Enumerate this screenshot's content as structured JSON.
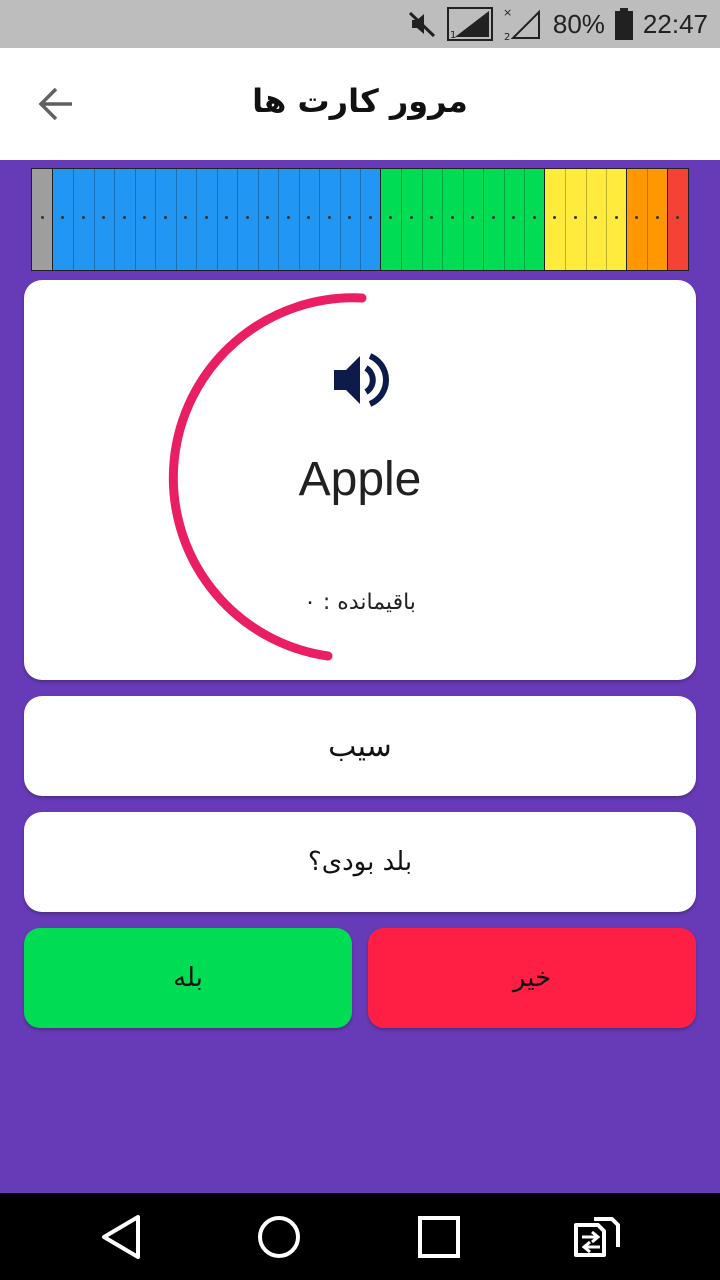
{
  "status_bar": {
    "battery_percent": "80%",
    "time": "22:47",
    "sim1_label": "1",
    "sim2_label": "2",
    "icons": [
      "mute-icon",
      "signal-sim1-icon",
      "signal-sim2-no-service-icon",
      "battery-icon"
    ]
  },
  "app_bar": {
    "title": "مرور کارت ها",
    "back_icon": "arrow-back-icon"
  },
  "leitner_boxes": [
    {
      "color": "#9e9e9e",
      "cells": 1
    },
    {
      "color": "#2196f3",
      "cells": 16
    },
    {
      "color": "#00dd55",
      "cells": 8
    },
    {
      "color": "#ffeb3b",
      "cells": 4
    },
    {
      "color": "#ff9800",
      "cells": 2
    },
    {
      "color": "#f44336",
      "cells": 1
    }
  ],
  "card": {
    "word": "Apple",
    "speaker_icon": "volume-up-icon",
    "remaining_label": "باقیمانده : ۰",
    "timer_color": "#e91e63"
  },
  "answer": {
    "translation": "سیب",
    "question": "بلد بودی؟"
  },
  "buttons": {
    "yes_label": "بله",
    "no_label": "خیر",
    "yes_color": "#00dd55",
    "no_color": "#ff1f45"
  },
  "nav_bar": {
    "icons": [
      "back-triangle-icon",
      "home-circle-icon",
      "recents-square-icon",
      "switch-sim-icon"
    ]
  }
}
